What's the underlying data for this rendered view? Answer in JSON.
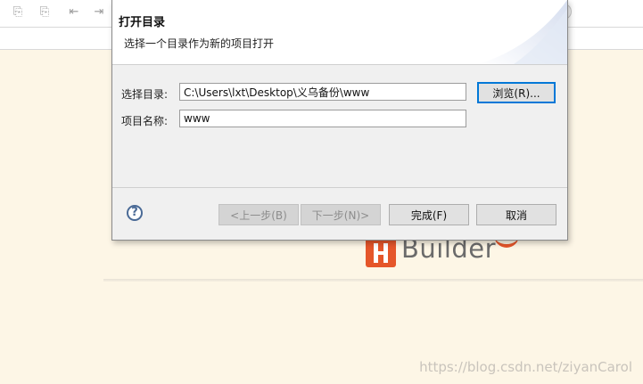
{
  "dialog": {
    "title": "打开目录",
    "subtitle": "选择一个目录作为新的项目打开",
    "directory_label": "选择目录:",
    "directory_value": "C:\\Users\\lxt\\Desktop\\义乌备份\\www",
    "browse_label": "浏览(R)...",
    "project_name_label": "项目名称:",
    "project_name_value": "www",
    "back_label": "<上一步(B)",
    "next_label": "下一步(N)>",
    "finish_label": "完成(F)",
    "cancel_label": "取消",
    "help_glyph": "?"
  },
  "background": {
    "logo_text": "Builder",
    "watermark": "https://blog.csdn.net/ziyanCarol"
  },
  "colors": {
    "accent": "#0078d7",
    "brand": "#e5562a",
    "page_bg": "#fdf6e6"
  }
}
